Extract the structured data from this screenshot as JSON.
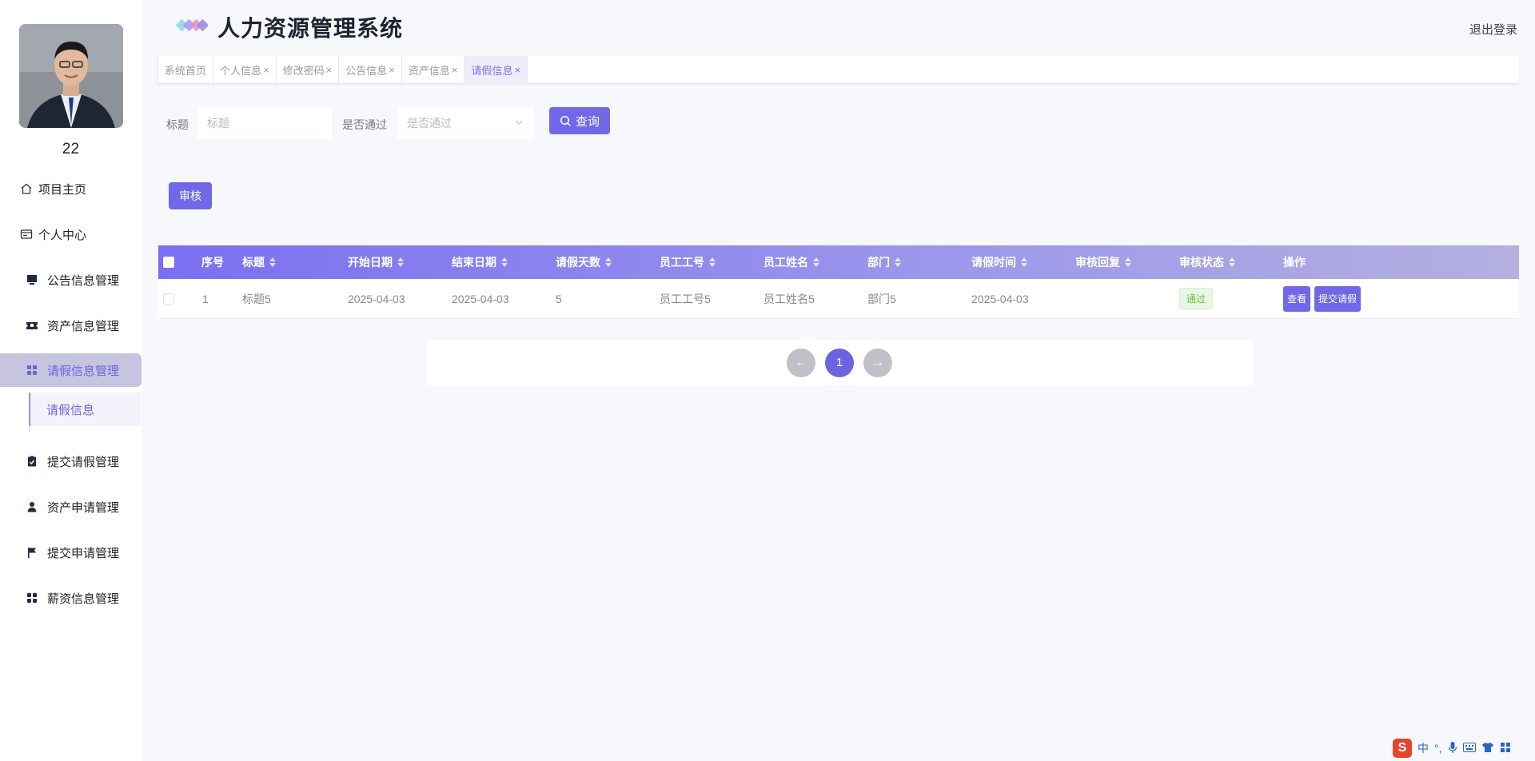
{
  "app": {
    "title": "人力资源管理系统",
    "logout": "退出登录"
  },
  "user": {
    "name": "22"
  },
  "sidebar": {
    "items": [
      {
        "label": "项目主页",
        "icon": "home-icon"
      },
      {
        "label": "个人中心",
        "icon": "id-card-icon"
      },
      {
        "label": "公告信息管理",
        "icon": "monitor-icon"
      },
      {
        "label": "资产信息管理",
        "icon": "ticket-icon"
      },
      {
        "label": "请假信息管理",
        "icon": "grid-icon",
        "active": true
      },
      {
        "label": "提交请假管理",
        "icon": "clipboard-check-icon"
      },
      {
        "label": "资产申请管理",
        "icon": "user-icon"
      },
      {
        "label": "提交申请管理",
        "icon": "flag-icon"
      },
      {
        "label": "薪资信息管理",
        "icon": "grid-icon"
      }
    ],
    "submenu": {
      "label": "请假信息"
    }
  },
  "tabs": [
    {
      "label": "系统首页",
      "closable": false
    },
    {
      "label": "个人信息",
      "closable": true
    },
    {
      "label": "修改密码",
      "closable": true
    },
    {
      "label": "公告信息",
      "closable": true
    },
    {
      "label": "资产信息",
      "closable": true
    },
    {
      "label": "请假信息",
      "closable": true,
      "active": true
    }
  ],
  "tab_close_glyph": "×",
  "search": {
    "title_label": "标题",
    "title_placeholder": "标题",
    "title_value": "",
    "approved_label": "是否通过",
    "approved_placeholder": "是否通过",
    "query_button": "查询"
  },
  "actions": {
    "audit_button": "审核"
  },
  "table": {
    "columns": [
      "序号",
      "标题",
      "开始日期",
      "结束日期",
      "请假天数",
      "员工工号",
      "员工姓名",
      "部门",
      "请假时间",
      "审核回复",
      "审核状态",
      "操作"
    ],
    "rows": [
      {
        "index": "1",
        "title": "标题5",
        "start_date": "2025-04-03",
        "end_date": "2025-04-03",
        "days": "5",
        "emp_no": "员工工号5",
        "emp_name": "员工姓名5",
        "dept": "部门5",
        "leave_time": "2025-04-03",
        "reply": "",
        "status": "通过",
        "ops": [
          "查看",
          "提交请假"
        ]
      }
    ]
  },
  "pagination": {
    "prev": "←",
    "current": "1",
    "next": "→"
  },
  "ime": {
    "s": "S",
    "lang": "中",
    "punct": "°,"
  },
  "colors": {
    "accent": "#7068e8",
    "active_bg": "#c7c4e0",
    "success": "#67c23a"
  }
}
